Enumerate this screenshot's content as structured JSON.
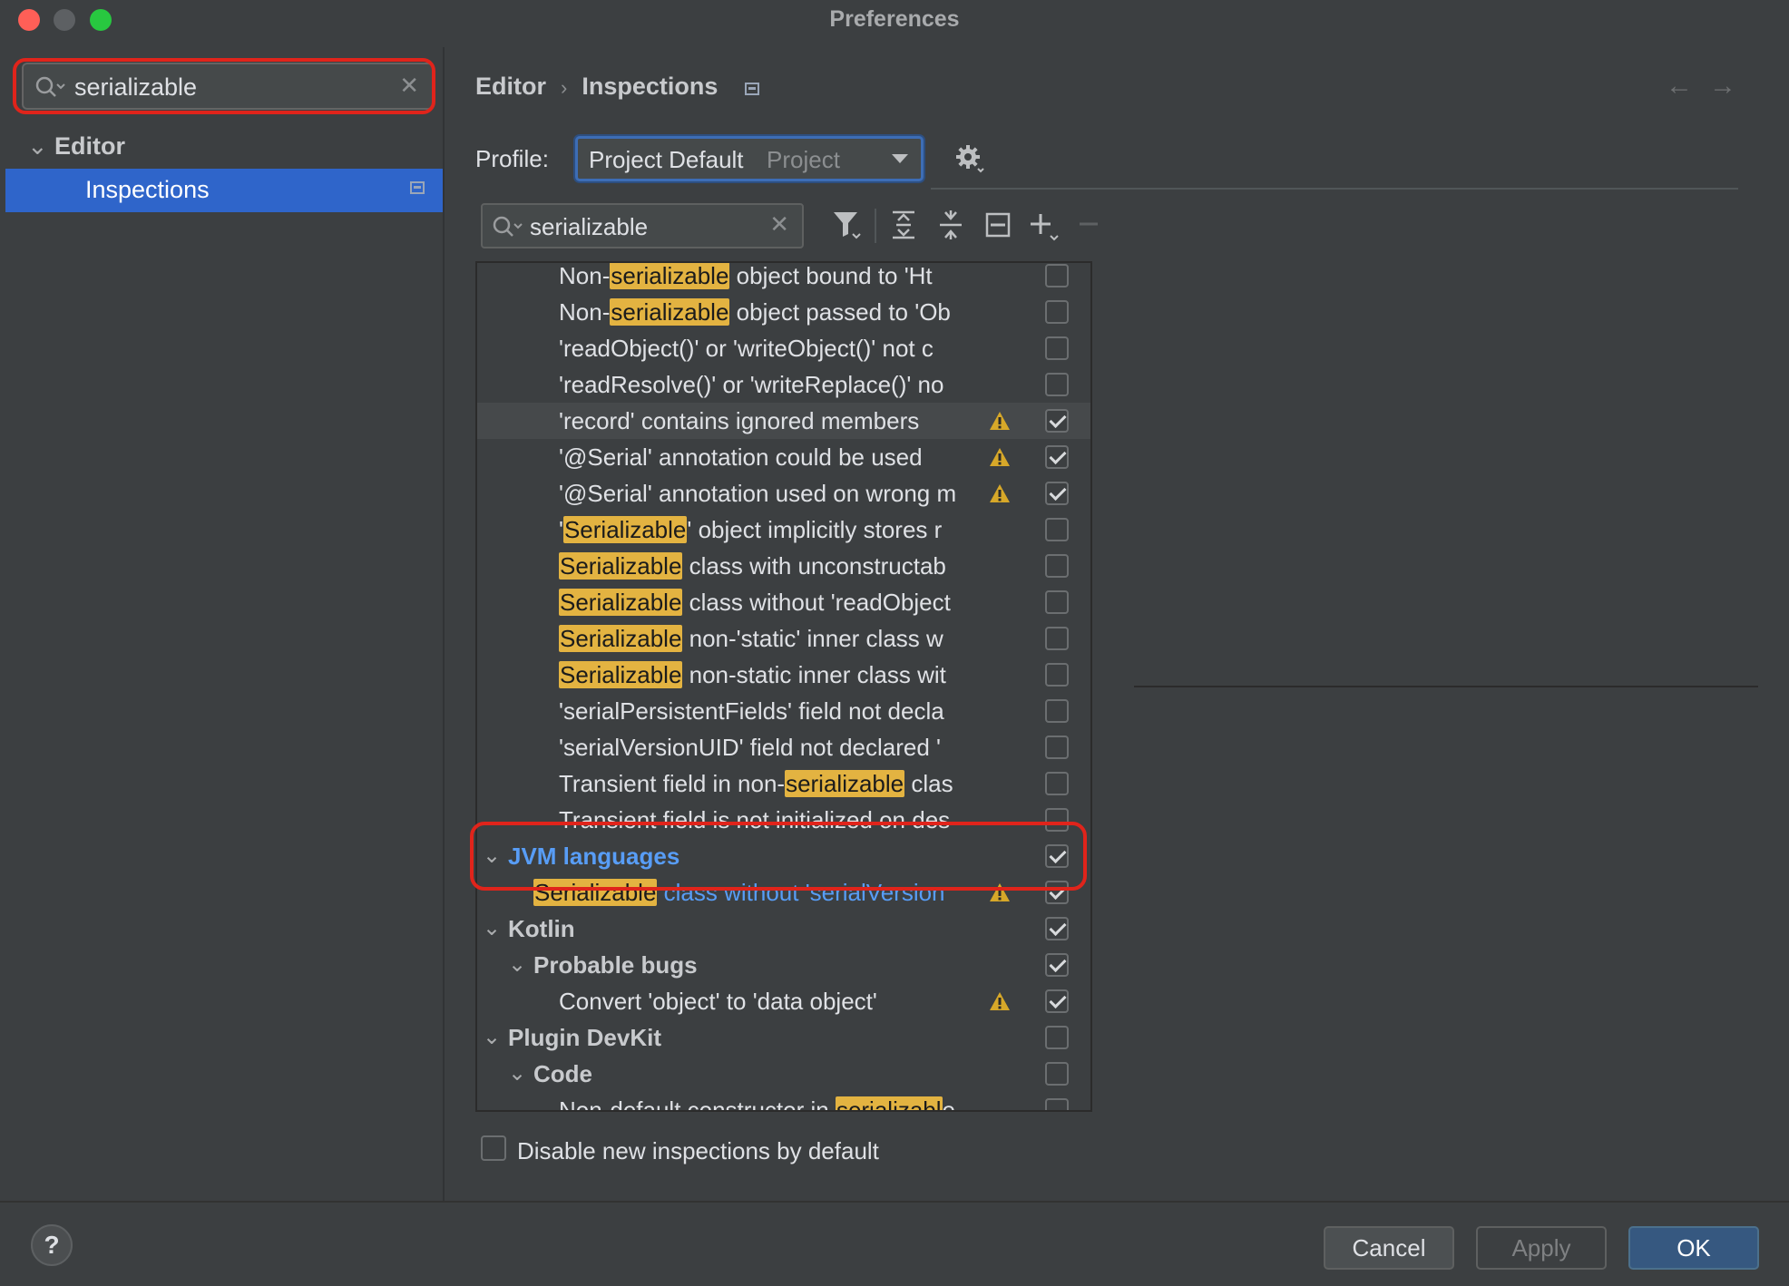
{
  "window": {
    "title": "Preferences"
  },
  "sidebar": {
    "search": {
      "value": "serializable",
      "clear_glyph": "✕"
    },
    "tree": {
      "group": "Editor",
      "selected_item": "Inspections"
    }
  },
  "main": {
    "breadcrumb": {
      "part1": "Editor",
      "separator": "›",
      "part2": "Inspections"
    },
    "nav": {
      "back": "←",
      "forward": "→"
    },
    "profile": {
      "label": "Profile:",
      "value": "Project Default",
      "scope": "Project"
    },
    "filter": {
      "value": "serializable",
      "clear_glyph": "✕"
    },
    "toolbar_icons": [
      "filter-icon",
      "expand-all-icon",
      "collapse-all-icon",
      "reset-icon",
      "add-icon",
      "remove-icon"
    ],
    "rows": [
      {
        "pre": "Non-",
        "mark": "serializable",
        "post": " object bound to 'Ht",
        "checked": false,
        "warn": false
      },
      {
        "pre": "Non-",
        "mark": "serializable",
        "post": " object passed to 'Ob",
        "checked": false,
        "warn": false
      },
      {
        "pre": "'readObject()' or 'writeObject()' not c",
        "mark": "",
        "post": "",
        "checked": false,
        "warn": false
      },
      {
        "pre": "'readResolve()' or 'writeReplace()' no",
        "mark": "",
        "post": "",
        "checked": false,
        "warn": false
      },
      {
        "pre": "'record' contains ignored members",
        "mark": "",
        "post": "",
        "checked": true,
        "warn": true
      },
      {
        "pre": "'@Serial' annotation could be used",
        "mark": "",
        "post": "",
        "checked": true,
        "warn": true
      },
      {
        "pre": "'@Serial' annotation used on wrong m",
        "mark": "",
        "post": "",
        "checked": true,
        "warn": true
      },
      {
        "pre": "'",
        "mark": "Serializable",
        "post": "' object implicitly stores r",
        "checked": false,
        "warn": false
      },
      {
        "pre": "",
        "mark": "Serializable",
        "post": " class with unconstructab",
        "checked": false,
        "warn": false
      },
      {
        "pre": "",
        "mark": "Serializable",
        "post": " class without 'readObject",
        "checked": false,
        "warn": false
      },
      {
        "pre": "",
        "mark": "Serializable",
        "post": " non-'static' inner class w",
        "checked": false,
        "warn": false
      },
      {
        "pre": "",
        "mark": "Serializable",
        "post": " non-static inner class wit",
        "checked": false,
        "warn": false
      },
      {
        "pre": "'serialPersistentFields' field not decla",
        "mark": "",
        "post": "",
        "checked": false,
        "warn": false
      },
      {
        "pre": "'serialVersionUID' field not declared '",
        "mark": "",
        "post": "",
        "checked": false,
        "warn": false
      },
      {
        "pre": "Transient field in non-",
        "mark": "serializable",
        "post": " clas",
        "checked": false,
        "warn": false
      },
      {
        "pre": "Transient field is not initialized on des",
        "mark": "",
        "post": "",
        "checked": false,
        "warn": false
      }
    ],
    "jvm_group": {
      "label": "JVM languages",
      "checked": true
    },
    "jvm_item": {
      "mark": "Serializable",
      "post": " class without 'serialVersionU",
      "checked": true
    },
    "kotlin_group": {
      "label": "Kotlin",
      "checked": true
    },
    "probable_bugs": {
      "label": "Probable bugs",
      "checked": true
    },
    "kotlin_item": {
      "label": "Convert 'object' to 'data object'",
      "checked": true
    },
    "devkit_group": {
      "label": "Plugin DevKit",
      "checked": false
    },
    "code_group": {
      "label": "Code",
      "checked": false
    },
    "devkit_item": {
      "pre": "Non-default constructor in ",
      "mark": "serializabl",
      "post": "e",
      "checked": false
    },
    "disable_new": {
      "label": "Disable new inspections by default",
      "checked": false
    }
  },
  "footer": {
    "help": "?",
    "cancel": "Cancel",
    "apply": "Apply",
    "ok": "OK"
  },
  "colors": {
    "selection": "#2f65ca",
    "highlight": "#e3b341",
    "link_blue": "#589df6",
    "annotation_red": "#e0241b",
    "warning": "#d7a829"
  }
}
